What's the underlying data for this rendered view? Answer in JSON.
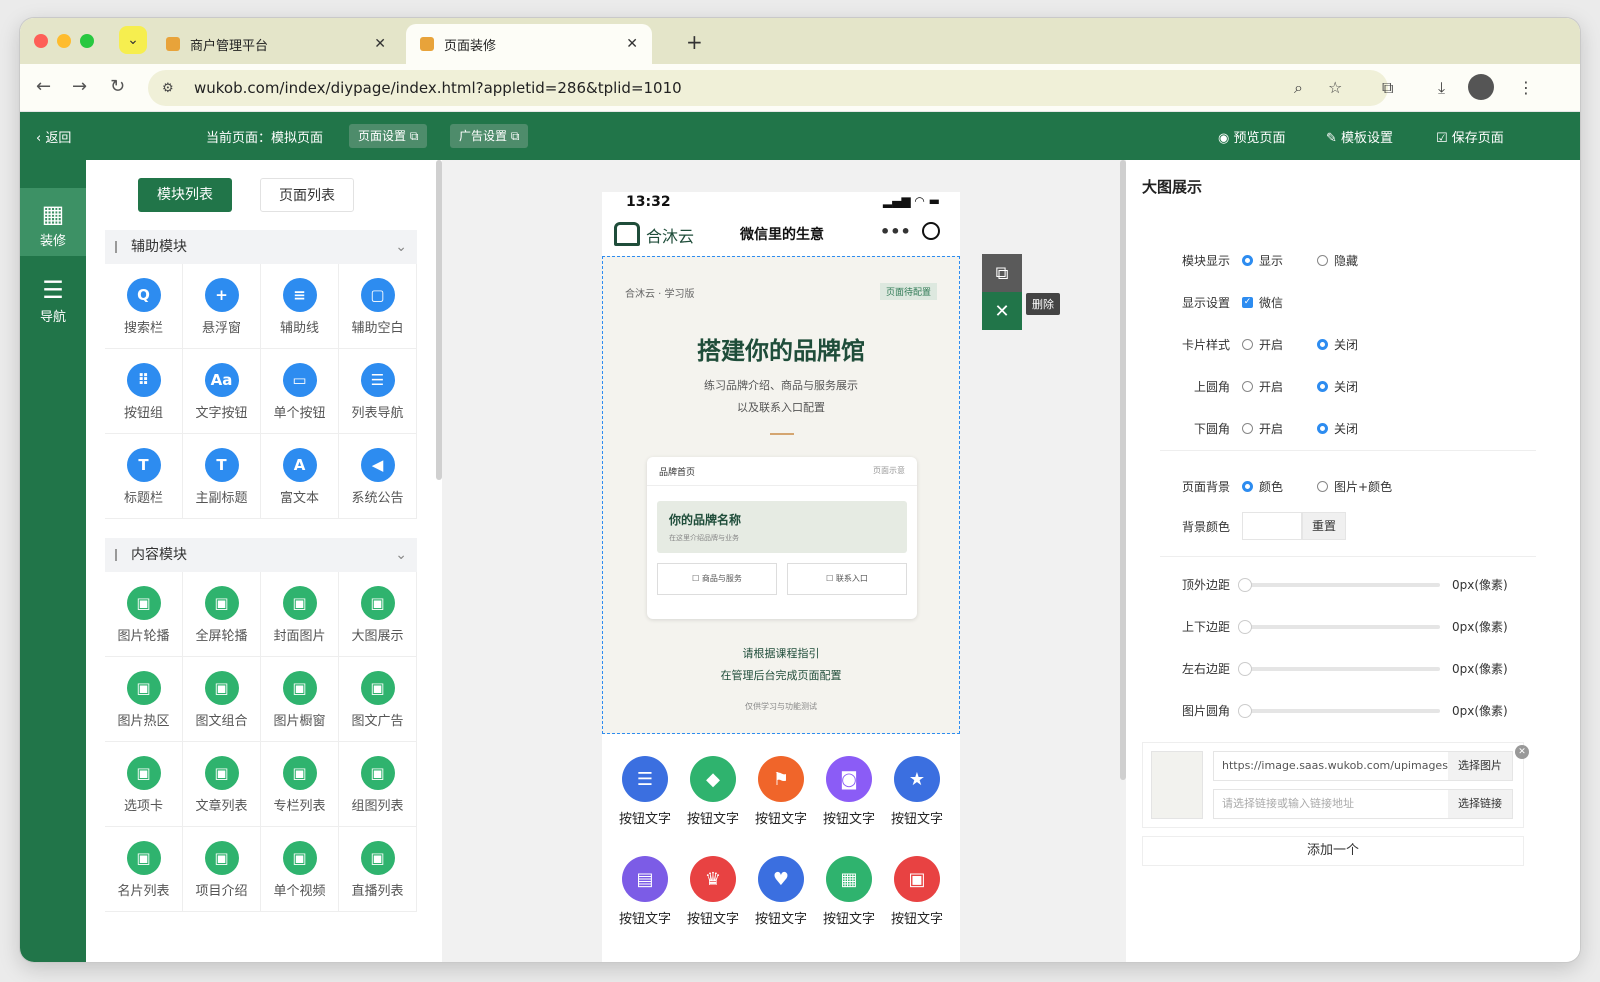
{
  "browser": {
    "tabs": [
      {
        "title": "商户管理平台"
      },
      {
        "title": "页面装修"
      }
    ],
    "url": "wukob.com/index/diypage/index.html?appletid=286&tplid=1010"
  },
  "appbar": {
    "back": "返回",
    "current_page_label": "当前页面：模拟页面",
    "page_settings": "页面设置",
    "ad_settings": "广告设置",
    "preview": "预览页面",
    "template_settings": "模板设置",
    "save": "保存页面"
  },
  "rail": {
    "items": [
      {
        "label": "装修"
      },
      {
        "label": "导航"
      }
    ]
  },
  "modules": {
    "tab_module_list": "模块列表",
    "tab_page_list": "页面列表",
    "aux_title": "辅助模块",
    "aux_items": [
      "搜索栏",
      "悬浮窗",
      "辅助线",
      "辅助空白",
      "按钮组",
      "文字按钮",
      "单个按钮",
      "列表导航",
      "标题栏",
      "主副标题",
      "富文本",
      "系统公告"
    ],
    "aux_glyphs": [
      "Q",
      "+",
      "≡",
      "▢",
      "⠿",
      "Aa",
      "▭",
      "☰",
      "T",
      "T",
      "A",
      "◀"
    ],
    "content_title": "内容模块",
    "content_items": [
      "图片轮播",
      "全屏轮播",
      "封面图片",
      "大图展示",
      "图片热区",
      "图文组合",
      "图片橱窗",
      "图文广告",
      "选项卡",
      "文章列表",
      "专栏列表",
      "组图列表",
      "名片列表",
      "项目介绍",
      "单个视频",
      "直播列表"
    ]
  },
  "phone": {
    "time": "13:32",
    "brand": "合沐云",
    "title": "微信里的生意",
    "hero": {
      "kicker": "合沐云 · 学习版",
      "badge": "页面待配置",
      "headline": "搭建你的品牌馆",
      "sub1": "练习品牌介绍、商品与服务展示",
      "sub2": "以及联系入口配置",
      "card_title": "品牌首页",
      "card_tag": "页面示意",
      "brand_name": "你的品牌名称",
      "brand_desc": "在这里介绍品牌与业务",
      "btn1": "商品与服务",
      "btn2": "联系入口",
      "guide1": "请根据课程指引",
      "guide2": "在管理后台完成页面配置",
      "note": "仅供学习与功能测试"
    },
    "buttons": [
      {
        "label": "按钮文字",
        "color": "#3b6fe0",
        "glyph": "☰"
      },
      {
        "label": "按钮文字",
        "color": "#2fb36e",
        "glyph": "◆"
      },
      {
        "label": "按钮文字",
        "color": "#f0652a",
        "glyph": "⚑"
      },
      {
        "label": "按钮文字",
        "color": "#8b5cf6",
        "glyph": "◙"
      },
      {
        "label": "按钮文字",
        "color": "#3b6fe0",
        "glyph": "★"
      },
      {
        "label": "按钮文字",
        "color": "#7c5ce6",
        "glyph": "▤"
      },
      {
        "label": "按钮文字",
        "color": "#e84242",
        "glyph": "♛"
      },
      {
        "label": "按钮文字",
        "color": "#3b6fe0",
        "glyph": "♥"
      },
      {
        "label": "按钮文字",
        "color": "#2fb36e",
        "glyph": "▦"
      },
      {
        "label": "按钮文字",
        "color": "#e84242",
        "glyph": "▣"
      }
    ]
  },
  "float": {
    "delete_tip": "删除"
  },
  "settings": {
    "title": "大图展示",
    "module_display": "模块显示",
    "show": "显示",
    "hide": "隐藏",
    "display_settings": "显示设置",
    "wechat": "微信",
    "card_style": "卡片样式",
    "top_radius": "上圆角",
    "bottom_radius": "下圆角",
    "on": "开启",
    "off": "关闭",
    "page_bg": "页面背景",
    "color": "颜色",
    "img_color": "图片+颜色",
    "bg_color": "背景颜色",
    "reset": "重置",
    "top_margin": "顶外边距",
    "tb_margin": "上下边距",
    "lr_margin": "左右边距",
    "img_radius": "图片圆角",
    "px_value": "0px(像素)",
    "image_url": "https://image.saas.wukob.com/upimages/",
    "choose_image": "选择图片",
    "link_placeholder": "请选择链接或输入链接地址",
    "choose_link": "选择链接",
    "add_one": "添加一个"
  },
  "colors": {
    "brand_green": "#217549",
    "accent_blue": "#2d8cf0",
    "hero_headline": "#1f4d3a"
  }
}
